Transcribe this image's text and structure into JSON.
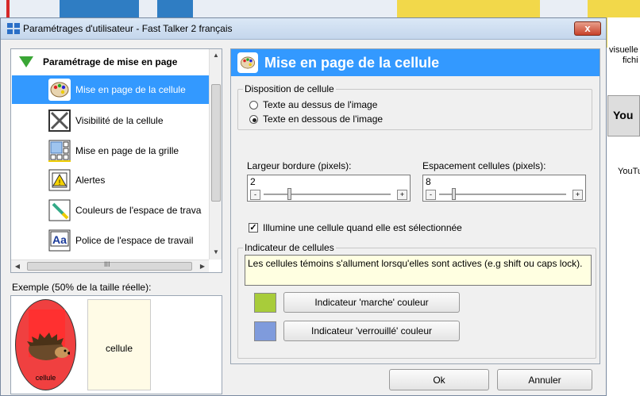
{
  "background": {
    "right_text_1": "visuelle",
    "right_text_2": "fichi",
    "right_text_3": "You",
    "right_text_4": "YouTu"
  },
  "window": {
    "title": "Paramétrages d'utilisateur - Fast Talker 2 français",
    "close_label": "x"
  },
  "nav": {
    "header": "Paramétrage de mise en page",
    "items": [
      {
        "label": "Mise en page de la cellule",
        "icon": "palette-icon",
        "selected": true
      },
      {
        "label": "Visibilité de la cellule",
        "icon": "cross-box-icon",
        "selected": false
      },
      {
        "label": "Mise en page de la grille",
        "icon": "grid-icon",
        "selected": false
      },
      {
        "label": "Alertes",
        "icon": "warning-icon",
        "selected": false
      },
      {
        "label": "Couleurs de l'espace de trava",
        "icon": "paint-brush-icon",
        "selected": false
      },
      {
        "label": "Police de l'espace de travail",
        "icon": "font-icon",
        "selected": false
      }
    ],
    "hscroll_thumb_text": "III"
  },
  "example": {
    "label": "Exemple (50% de la taille réelle):",
    "cell_image_label": "cellule",
    "cell_text_label": "cellule"
  },
  "panel": {
    "title": "Mise en page de la cellule",
    "disposition": {
      "title": "Disposition de cellule",
      "options": [
        {
          "label": "Texte au dessus de l'image",
          "selected": false
        },
        {
          "label": "Texte en dessous de l'image",
          "selected": true
        }
      ]
    },
    "border_width": {
      "label": "Largeur bordure (pixels):",
      "value": "2",
      "minus": "-",
      "plus": "+"
    },
    "cell_spacing": {
      "label": "Espacement cellules (pixels):",
      "value": "8",
      "minus": "-",
      "plus": "+"
    },
    "highlight_checkbox": {
      "label": "Illumine une cellule quand elle est sélectionnée",
      "checked": true,
      "mark": "✓"
    },
    "indicator": {
      "title": "Indicateur de cellules",
      "info": "Les cellules témoins s'allument lorsqu'elles sont actives (e.g shift ou caps lock).",
      "on_button": "Indicateur 'marche' couleur",
      "locked_button": "Indicateur 'verrouillé' couleur",
      "on_color": "#a8cc3a",
      "locked_color": "#7f9bdc"
    }
  },
  "footer": {
    "ok": "Ok",
    "cancel": "Annuler"
  },
  "colors": {
    "selection_blue": "#3399ff",
    "header_triangle": "#3aa635"
  }
}
